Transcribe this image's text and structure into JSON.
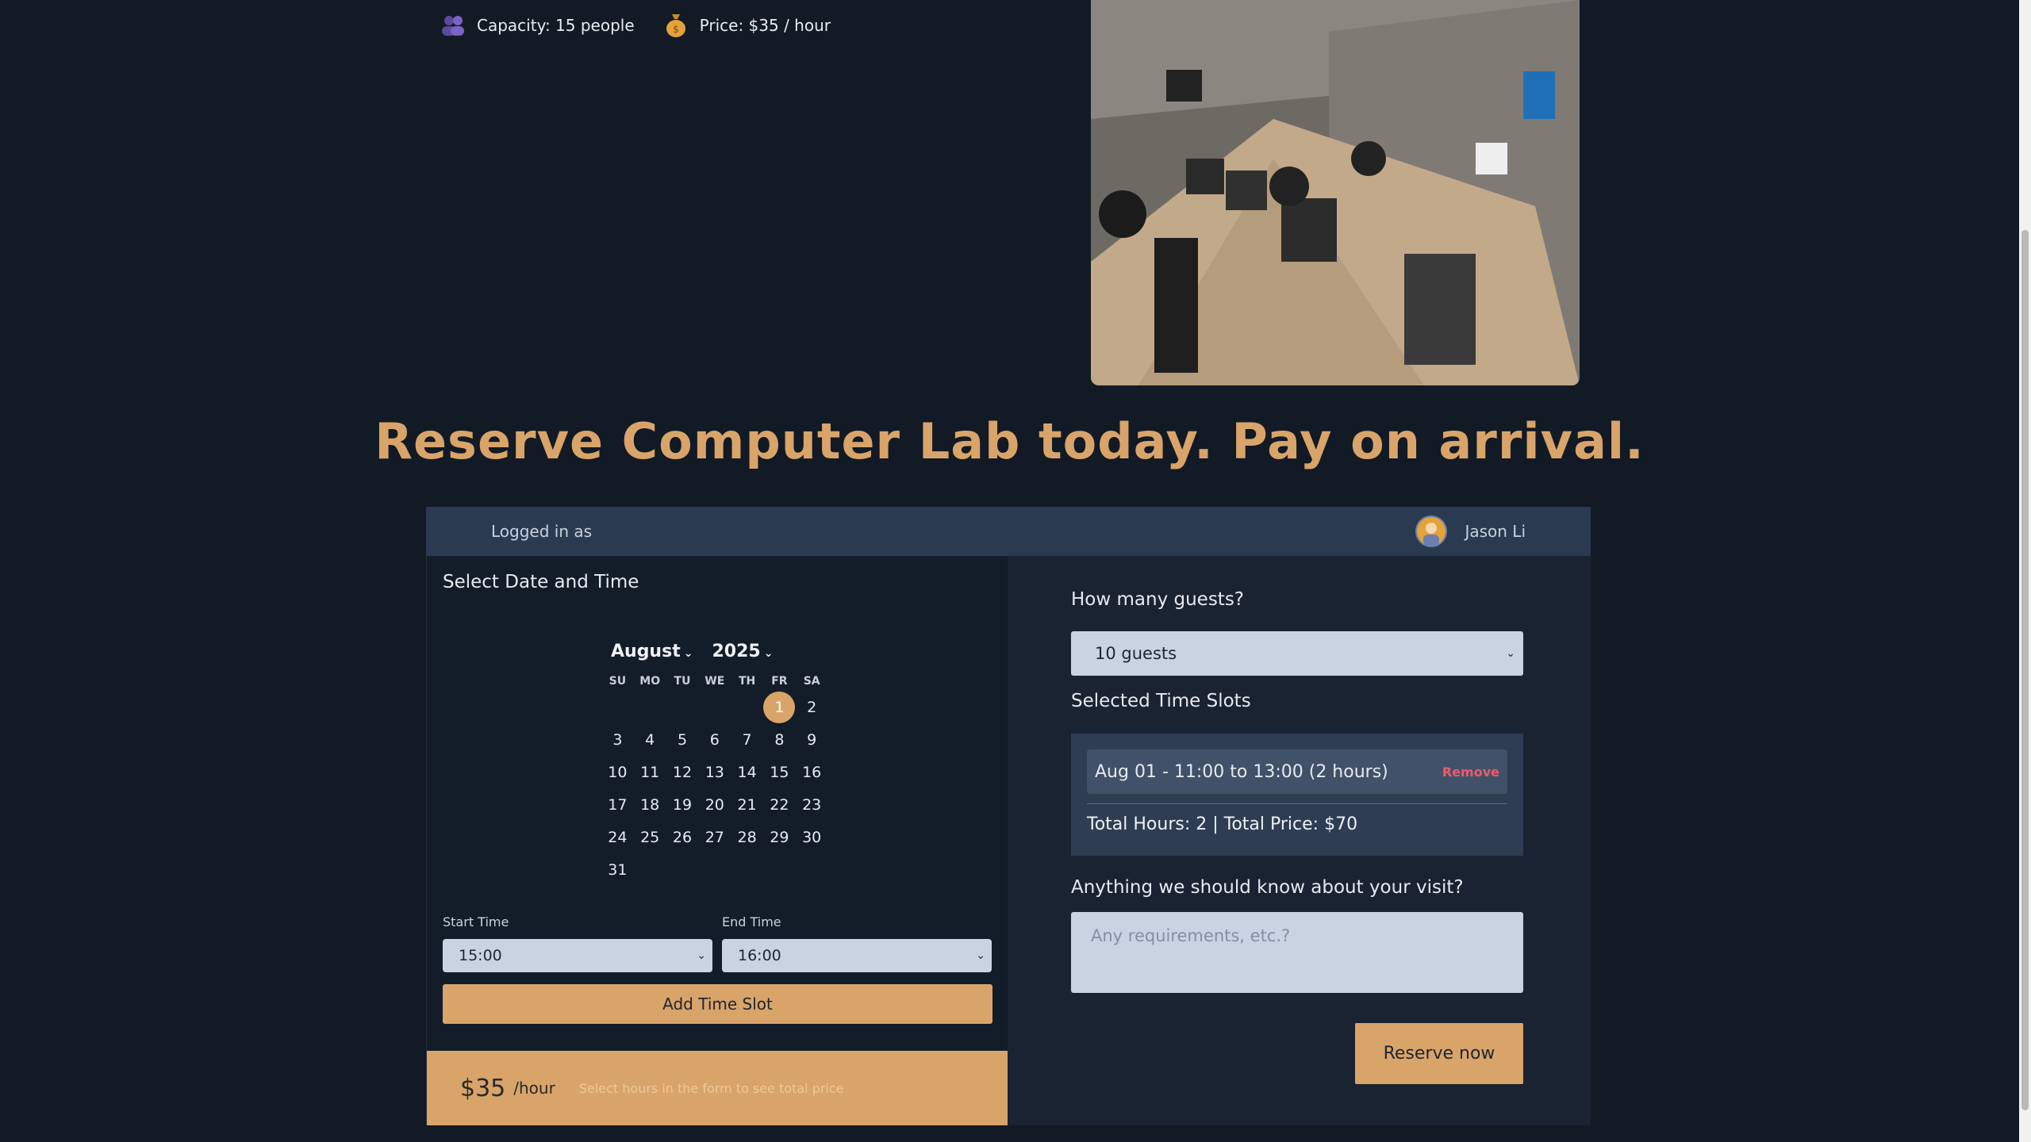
{
  "venue": {
    "capacity_text": "Capacity: 15 people",
    "price_text": "Price: $35 / hour",
    "capacity_icon": "people-icon",
    "price_icon": "money-bag-icon",
    "photo": "computer-lab-photo"
  },
  "headline": "Reserve Computer Lab today. Pay on arrival.",
  "session": {
    "logged_in_label": "Logged in as",
    "user_name": "Jason Li"
  },
  "calendar": {
    "section_title": "Select Date and Time",
    "month": "August",
    "year": "2025",
    "weekdays": [
      "SU",
      "MO",
      "TU",
      "WE",
      "TH",
      "FR",
      "SA"
    ],
    "weeks": [
      [
        "",
        "",
        "",
        "",
        "",
        "1",
        "2"
      ],
      [
        "3",
        "4",
        "5",
        "6",
        "7",
        "8",
        "9"
      ],
      [
        "10",
        "11",
        "12",
        "13",
        "14",
        "15",
        "16"
      ],
      [
        "17",
        "18",
        "19",
        "20",
        "21",
        "22",
        "23"
      ],
      [
        "24",
        "25",
        "26",
        "27",
        "28",
        "29",
        "30"
      ],
      [
        "31",
        "",
        "",
        "",
        "",
        "",
        ""
      ]
    ],
    "selected_day": "1"
  },
  "time": {
    "start_label": "Start Time",
    "start_value": "15:00",
    "end_label": "End Time",
    "end_value": "16:00",
    "add_button": "Add Time Slot"
  },
  "price_bar": {
    "amount": "$35",
    "unit": "/hour",
    "hint": "Select hours in the form to see total price"
  },
  "booking": {
    "guests_label": "How many guests?",
    "guests_value": "10 guests",
    "slots_label": "Selected Time Slots",
    "slot_text": "Aug 01 - 11:00 to 13:00 (2 hours)",
    "remove_label": "Remove",
    "totals": "Total Hours: 2 | Total Price: $70",
    "notes_label": "Anything we should know about your visit?",
    "notes_placeholder": "Any requirements, etc.?",
    "reserve_button": "Reserve now"
  },
  "colors": {
    "accent": "#d9a46a",
    "background": "#121a25",
    "panel_header": "#2a3a50",
    "remove": "#ec5b6c"
  }
}
